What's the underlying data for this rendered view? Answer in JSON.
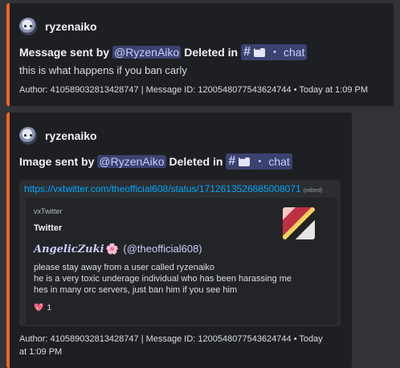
{
  "messages": [
    {
      "author": "ryzenaiko",
      "title_prefix": "Message sent by",
      "mention": "@RyzenAiko",
      "deleted_in": "Deleted in",
      "channel_hash": "#",
      "channel_sep": "・",
      "channel_name": "chat",
      "description": "this is what happens if you ban carly",
      "footer": "Author: 410589032813428747 | Message ID: 1200548077543624744 • Today at 1:09 PM"
    },
    {
      "author": "ryzenaiko",
      "title_prefix": "Image sent by",
      "mention": "@RyzenAiko",
      "deleted_in": "Deleted in",
      "channel_hash": "#",
      "channel_sep": "・",
      "channel_name": "chat",
      "link": "https://vxtwitter.com/theofficial608/status/1712613526685008071",
      "edited": "(edited)",
      "embed": {
        "provider": "vxTwitter",
        "title": "Twitter",
        "author_fancy": "AngelicZuki",
        "author_flower": "🌸",
        "author_handle": "(@theofficial608)",
        "text": "please stay away from a user called ryzenaiko\nhe is a very toxic underage individual who has been harassing me\nhes in many orc servers, just ban him if you see him",
        "likes_icon": "💖",
        "likes": "1"
      },
      "footer_line1": "Author: 410589032813428747 | Message ID: 1200548077543624744 • Today",
      "footer_line2": "at 1:09 PM"
    }
  ],
  "colors": {
    "accent": "#f26522",
    "link": "#00a8fc",
    "mention_bg": "#3c4270"
  }
}
